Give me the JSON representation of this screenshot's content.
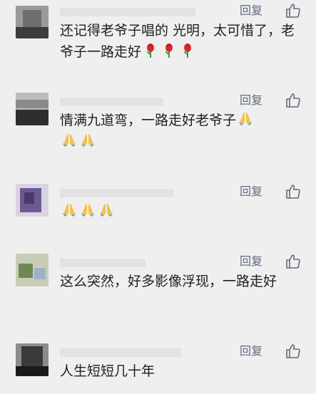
{
  "comments": [
    {
      "reply_label": "回复",
      "text": "还记得老爷子唱的 光明，太可惜了，老爷子一路走好",
      "emoji": [
        "rose-emoji",
        "rose-emoji",
        "rose-emoji"
      ]
    },
    {
      "reply_label": "回复",
      "text": "情满九道弯，一路走好老爷子",
      "emoji": [
        "praying-hands-emoji",
        "praying-hands-emoji",
        "praying-hands-emoji"
      ]
    },
    {
      "reply_label": "回复",
      "text": "",
      "emoji": [
        "praying-hands-emoji",
        "praying-hands-emoji",
        "praying-hands-emoji"
      ]
    },
    {
      "reply_label": "回复",
      "text": "这么突然，好多影像浮现，一路走好",
      "emoji": []
    },
    {
      "reply_label": "回复",
      "text": "人生短短几十年",
      "emoji": []
    }
  ],
  "colors": {
    "background": "#efefef",
    "reply_link": "#606a80",
    "text": "#1f1f1f"
  },
  "icons": {
    "like": "thumbs-up-icon"
  }
}
